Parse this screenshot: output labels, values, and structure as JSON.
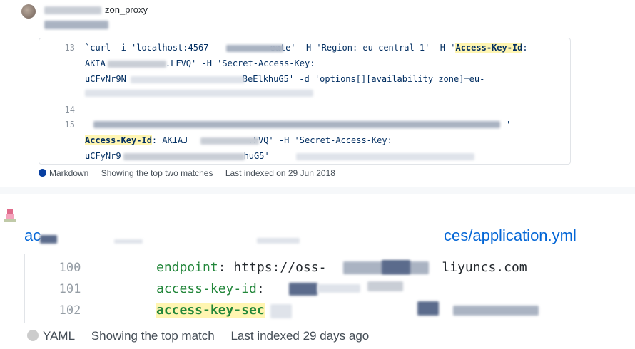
{
  "result1": {
    "repo_suffix": "zon_proxy",
    "lines": [
      {
        "num": "13",
        "parts": [
          {
            "text": "`curl -i 'localhost:4567",
            "hl": false
          },
          {
            "text": "eate' -H 'Region: eu-central-1' -H '",
            "hl": false
          },
          {
            "text": "Access-Key-Id",
            "hl": true
          },
          {
            "text": ":",
            "hl": false
          }
        ]
      },
      {
        "num": "",
        "parts": [
          {
            "text": "AKIA",
            "hl": false
          },
          {
            "text": ".LFVQ' -H 'Secret-Access-Key:",
            "hl": false
          }
        ]
      },
      {
        "num": "",
        "parts": [
          {
            "text": "uCFvNr9N",
            "hl": false
          },
          {
            "text": "BeElkhuG5' -d 'options[][availability zone]=eu-",
            "hl": false
          }
        ]
      },
      {
        "num": "14",
        "parts": []
      },
      {
        "num": "15",
        "parts": [
          {
            "text": "'",
            "hl": false
          }
        ]
      },
      {
        "num": "",
        "parts": [
          {
            "text": "Access-Key-Id",
            "hl": true
          },
          {
            "text": ": AKIAJ",
            "hl": false
          },
          {
            "text": ".FVQ' -H 'Secret-Access-Key:",
            "hl": false
          }
        ]
      },
      {
        "num": "",
        "parts": [
          {
            "text": "uCFyNr9",
            "hl": false
          },
          {
            "text": "huG5'",
            "hl": false
          }
        ]
      }
    ],
    "language": "Markdown",
    "language_color": "#083fa1",
    "matches": "Showing the top two matches",
    "indexed": "Last indexed on 29 Jun 2018"
  },
  "result2": {
    "repo_prefix": "ac",
    "path": "ces/application.yml",
    "lines": [
      {
        "num": "100",
        "key": "endpoint",
        "value": ": https://oss-",
        "tail": "liyuncs.com",
        "hl": false
      },
      {
        "num": "101",
        "key": "access-key-id",
        "value": ":",
        "tail": "",
        "hl": false
      },
      {
        "num": "102",
        "key": "access-key-sec",
        "value": "",
        "tail": "",
        "hl": true
      }
    ],
    "language": "YAML",
    "language_color": "#cccccc",
    "matches": "Showing the top match",
    "indexed": "Last indexed 29 days ago"
  }
}
